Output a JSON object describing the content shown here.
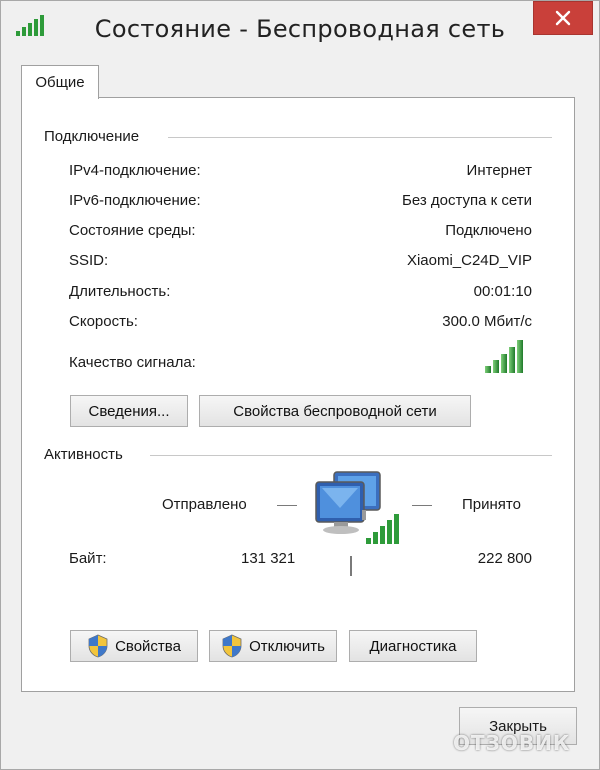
{
  "window": {
    "title": "Состояние - Беспроводная сеть"
  },
  "tabs": [
    {
      "label": "Общие"
    }
  ],
  "connection": {
    "section_label": "Подключение",
    "rows": [
      {
        "label": "IPv4-подключение:",
        "value": "Интернет"
      },
      {
        "label": "IPv6-подключение:",
        "value": "Без доступа к сети"
      },
      {
        "label": "Состояние среды:",
        "value": "Подключено"
      },
      {
        "label": "SSID:",
        "value": "Xiaomi_C24D_VIP"
      },
      {
        "label": "Длительность:",
        "value": "00:01:10"
      },
      {
        "label": "Скорость:",
        "value": "300.0 Мбит/с"
      }
    ],
    "signal_label": "Качество сигнала:",
    "signal_bars": 5,
    "details_button": "Сведения...",
    "wireless_props_button": "Свойства беспроводной сети"
  },
  "activity": {
    "section_label": "Активность",
    "sent_label": "Отправлено",
    "received_label": "Принято",
    "bytes_label": "Байт:",
    "bytes_sent": "131 321",
    "bytes_received": "222 800"
  },
  "buttons": {
    "properties": "Свойства",
    "disable": "Отключить",
    "diagnose": "Диагностика",
    "close": "Закрыть"
  },
  "watermark": "ОТЗОВИК",
  "colors": {
    "signal_green": "#2e9b3a",
    "close_red": "#c9403a",
    "panel_bg": "#ffffff",
    "window_bg": "#f0f0f0"
  },
  "icons": {
    "title": "signal-bars-icon",
    "close": "close-icon",
    "shield": "uac-shield-icon",
    "network": "network-computers-icon"
  }
}
